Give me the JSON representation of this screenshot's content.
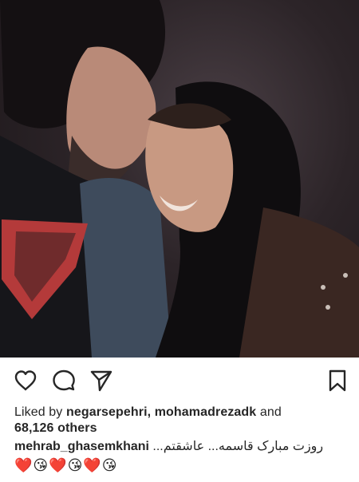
{
  "post": {
    "likes": {
      "prefix": "Liked by ",
      "user_1": "negarsepehri",
      "separator": ", ",
      "user_2": "mohamadrezadk",
      "and_text": " and",
      "others_count": "68,126 others"
    },
    "caption": {
      "username": "mehrab_ghasemkhani",
      "text": " ...روزت مبارک قاسمه... عاشقتم",
      "emojis": "❤️😘❤️😘❤️😘"
    }
  },
  "icons": {
    "like": "heart-outline",
    "comment": "speech-bubble",
    "share": "paper-plane",
    "save": "bookmark"
  },
  "colors": {
    "text": "#262626",
    "background": "#ffffff",
    "photo_dark": "#1a1518"
  }
}
